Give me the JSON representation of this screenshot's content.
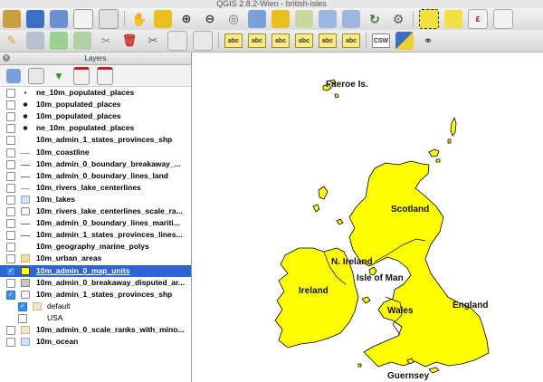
{
  "window": {
    "title": "QGIS 2.8.2-Wien - british-isles"
  },
  "toolbar": {
    "csw_label": "CSW",
    "label_tool_text": "abc",
    "icons_row1": [
      "open-project-icon",
      "save-project-icon",
      "save-as-icon",
      "new-print-composer-icon",
      "composer-manager-icon",
      "pan-icon",
      "pan-to-selection-icon",
      "zoom-in-icon",
      "zoom-out-icon",
      "zoom-native-icon",
      "zoom-full-icon",
      "zoom-to-selection-icon",
      "zoom-to-layer-icon",
      "zoom-last-icon",
      "zoom-next-icon",
      "refresh-icon",
      "identify-icon",
      "select-features-icon",
      "deselect-icon",
      "field-calculator-icon",
      "attribute-table-icon"
    ],
    "icons_row2": [
      "current-edits-icon",
      "toggle-editing-icon",
      "add-feature-icon",
      "move-feature-icon",
      "node-tool-icon",
      "delete-selected-icon",
      "cut-features-icon",
      "copy-features-icon",
      "paste-features-icon",
      "label-icon",
      "pin-labels-icon",
      "highlight-labels-icon",
      "move-label-icon",
      "rotate-label-icon",
      "change-label-icon",
      "csw-icon",
      "python-console-icon",
      "binoculars-icon"
    ]
  },
  "layers_panel": {
    "title": "Layers",
    "toolbar_icons": [
      "open-layer-styling-icon",
      "add-group-icon",
      "filter-legend-icon",
      "expand-all-icon",
      "collapse-all-icon"
    ],
    "layers": [
      {
        "name": "ne_10m_populated_places",
        "checked": false,
        "symbol": "dot-small",
        "selected": false,
        "sub": false
      },
      {
        "name": "10m_populated_places",
        "checked": false,
        "symbol": "dot",
        "selected": false,
        "sub": false
      },
      {
        "name": "10m_populated_places",
        "checked": false,
        "symbol": "dot",
        "selected": false,
        "sub": false
      },
      {
        "name": "ne_10m_populated_places",
        "checked": false,
        "symbol": "dot",
        "selected": false,
        "sub": false
      },
      {
        "name": "10m_admin_1_states_provinces_shp",
        "checked": false,
        "symbol": "none",
        "selected": false,
        "sub": false
      },
      {
        "name": "10m_coastline",
        "checked": false,
        "symbol": "line-blue",
        "selected": false,
        "sub": false
      },
      {
        "name": "10m_admin_0_boundary_breakaway_...",
        "checked": false,
        "symbol": "line-dashed-red",
        "selected": false,
        "sub": false
      },
      {
        "name": "10m_admin_0_boundary_lines_land",
        "checked": false,
        "symbol": "line-gray",
        "selected": false,
        "sub": false
      },
      {
        "name": "10m_rivers_lake_centerlines",
        "checked": false,
        "symbol": "line-blue",
        "selected": false,
        "sub": false
      },
      {
        "name": "10m_lakes",
        "checked": false,
        "symbol": "fill-lightblue",
        "selected": false,
        "sub": false
      },
      {
        "name": "10m_rivers_lake_centerlines_scale_ra...",
        "checked": false,
        "symbol": "rule",
        "selected": false,
        "sub": false
      },
      {
        "name": "10m_admin_0_boundary_lines_mariti...",
        "checked": false,
        "symbol": "line-gray",
        "selected": false,
        "sub": false
      },
      {
        "name": "10m_admin_1_states_provinces_lines...",
        "checked": false,
        "symbol": "line-gray",
        "selected": false,
        "sub": false
      },
      {
        "name": "10m_geography_marine_polys",
        "checked": false,
        "symbol": "none",
        "selected": false,
        "sub": false
      },
      {
        "name": "10m_urban_areas",
        "checked": false,
        "symbol": "fill-tan",
        "selected": false,
        "sub": false
      },
      {
        "name": "10m_admin_0_map_units",
        "checked": true,
        "symbol": "fill-yellow",
        "selected": true,
        "sub": false
      },
      {
        "name": "10m_admin_0_breakaway_disputed_ar...",
        "checked": false,
        "symbol": "fill-gray",
        "selected": false,
        "sub": false
      },
      {
        "name": "10m_admin_1_states_provinces_shp",
        "checked": true,
        "symbol": "rule",
        "selected": false,
        "sub": false
      },
      {
        "name": "default",
        "checked": true,
        "symbol": "fill-beige",
        "selected": false,
        "sub": true
      },
      {
        "name": "USA",
        "checked": false,
        "symbol": "none",
        "selected": false,
        "sub": true
      },
      {
        "name": "10m_admin_0_scale_ranks_with_mino...",
        "checked": false,
        "symbol": "fill-beige",
        "selected": false,
        "sub": false
      },
      {
        "name": "10m_ocean",
        "checked": false,
        "symbol": "fill-lightblue",
        "selected": false,
        "sub": false
      }
    ]
  },
  "map": {
    "land_color": "#ffff00",
    "outline_color": "#000000",
    "labels": {
      "faroe": "Faeroe Is.",
      "scotland": "Scotland",
      "n_ireland": "N. Ireland",
      "isle_of_man": "Isle of Man",
      "ireland": "Ireland",
      "wales": "Wales",
      "england": "England",
      "guernsey": "Guernsey"
    }
  }
}
